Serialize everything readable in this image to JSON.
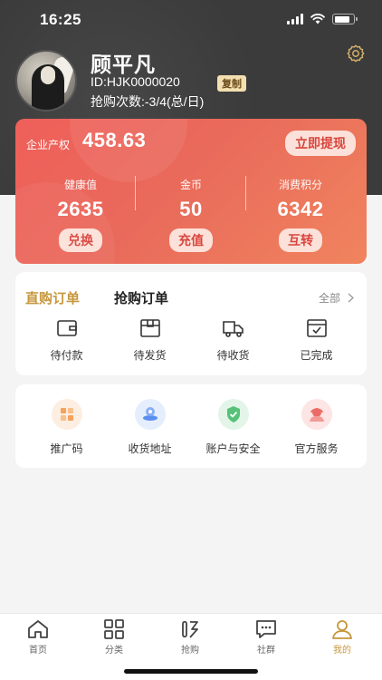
{
  "status_bar": {
    "time": "16:25"
  },
  "profile": {
    "name": "顾平凡",
    "id_text": "ID:HJK0000020",
    "copy_label": "复制",
    "grab_count_text": "抢购次数:-3/4(总/日)"
  },
  "assets": {
    "enterprise_label": "企业产权",
    "enterprise_value": "458.63",
    "withdraw_label": "立即提现",
    "stats": [
      {
        "label": "健康值",
        "value": "2635",
        "action": "兑换"
      },
      {
        "label": "金币",
        "value": "50",
        "action": "充值"
      },
      {
        "label": "消费积分",
        "value": "6342",
        "action": "互转"
      }
    ]
  },
  "orders": {
    "tab_direct": "直购订单",
    "tab_grab": "抢购订单",
    "all_label": "全部",
    "items": [
      {
        "label": "待付款",
        "icon": "wallet-icon"
      },
      {
        "label": "待发货",
        "icon": "package-icon"
      },
      {
        "label": "待收货",
        "icon": "truck-icon"
      },
      {
        "label": "已完成",
        "icon": "completed-icon"
      }
    ]
  },
  "services": {
    "items": [
      {
        "label": "推广码",
        "icon": "qr-code-icon",
        "color": "#f6a15c"
      },
      {
        "label": "收货地址",
        "icon": "location-icon",
        "color": "#5a8ff0"
      },
      {
        "label": "账户与安全",
        "icon": "shield-icon",
        "color": "#56c178"
      },
      {
        "label": "官方服务",
        "icon": "service-agent-icon",
        "color": "#ec6b66"
      }
    ]
  },
  "tabbar": {
    "items": [
      {
        "label": "首页",
        "icon": "home-icon"
      },
      {
        "label": "分类",
        "icon": "category-icon"
      },
      {
        "label": "抢购",
        "icon": "grab-icon"
      },
      {
        "label": "社群",
        "icon": "chat-icon"
      },
      {
        "label": "我的",
        "icon": "profile-icon",
        "active": true
      }
    ]
  },
  "colors": {
    "header_bg": "#3b3b3b",
    "card_gradient_start": "#ef5f5a",
    "card_gradient_end": "#f0845e",
    "accent_gold": "#c7973e",
    "button_text_red": "#d9453d"
  }
}
